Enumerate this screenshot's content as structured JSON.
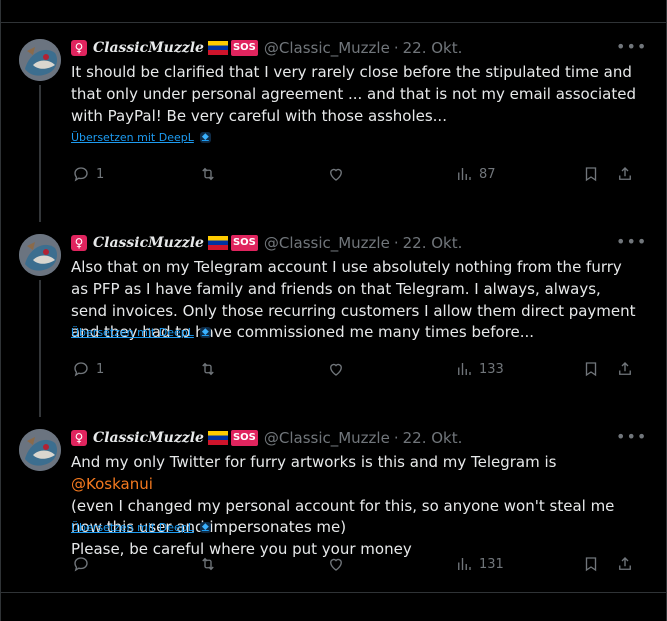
{
  "colors": {
    "background": "#000000",
    "text": "#e7e9ea",
    "muted": "#71767b",
    "link": "#1d9bf0",
    "mention": "#f4791f",
    "divider": "#2f3336"
  },
  "tweets": [
    {
      "user": {
        "display_name": "ClassicMuzzle",
        "handle": "@Classic_Muzzle",
        "badge_text": "SOS",
        "icons": [
          "female-sign-icon",
          "venezuela-flag-icon",
          "sos-icon"
        ]
      },
      "date": "22. Okt.",
      "text": "It should be clarified that I very rarely close before the stipulated time and that only under personal agreement ... and that is not my email associated with PayPal! Be very careful with those assholes...",
      "translate_label": "Übersetzen mit DeepL",
      "actions": {
        "replies": "1",
        "retweets": "",
        "likes": "",
        "views": "87"
      }
    },
    {
      "user": {
        "display_name": "ClassicMuzzle",
        "handle": "@Classic_Muzzle",
        "badge_text": "SOS",
        "icons": [
          "female-sign-icon",
          "venezuela-flag-icon",
          "sos-icon"
        ]
      },
      "date": "22. Okt.",
      "text": "Also that on my Telegram account I use absolutely nothing from the furry as PFP as I have family and friends on that Telegram. I always, always, send invoices. Only those recurring customers I allow them direct payment and they had to have commissioned me many times before...",
      "translate_label": "Übersetzen mit DeepL",
      "actions": {
        "replies": "1",
        "retweets": "",
        "likes": "",
        "views": "133"
      }
    },
    {
      "user": {
        "display_name": "ClassicMuzzle",
        "handle": "@Classic_Muzzle",
        "badge_text": "SOS",
        "icons": [
          "female-sign-icon",
          "venezuela-flag-icon",
          "sos-icon"
        ]
      },
      "date": "22. Okt.",
      "text_before_mention": "And my only Twitter for furry artworks is this and my Telegram is ",
      "mention": "@Koskanui",
      "text_after_mention_line1": "(even I changed my personal account for this, so anyone won't steal me now this user and impersonates me)",
      "text_line2": "Please, be careful where you put your money",
      "translate_label": "Übersetzen mit DeepL",
      "actions": {
        "replies": "",
        "retweets": "",
        "likes": "",
        "views": "131"
      }
    }
  ]
}
